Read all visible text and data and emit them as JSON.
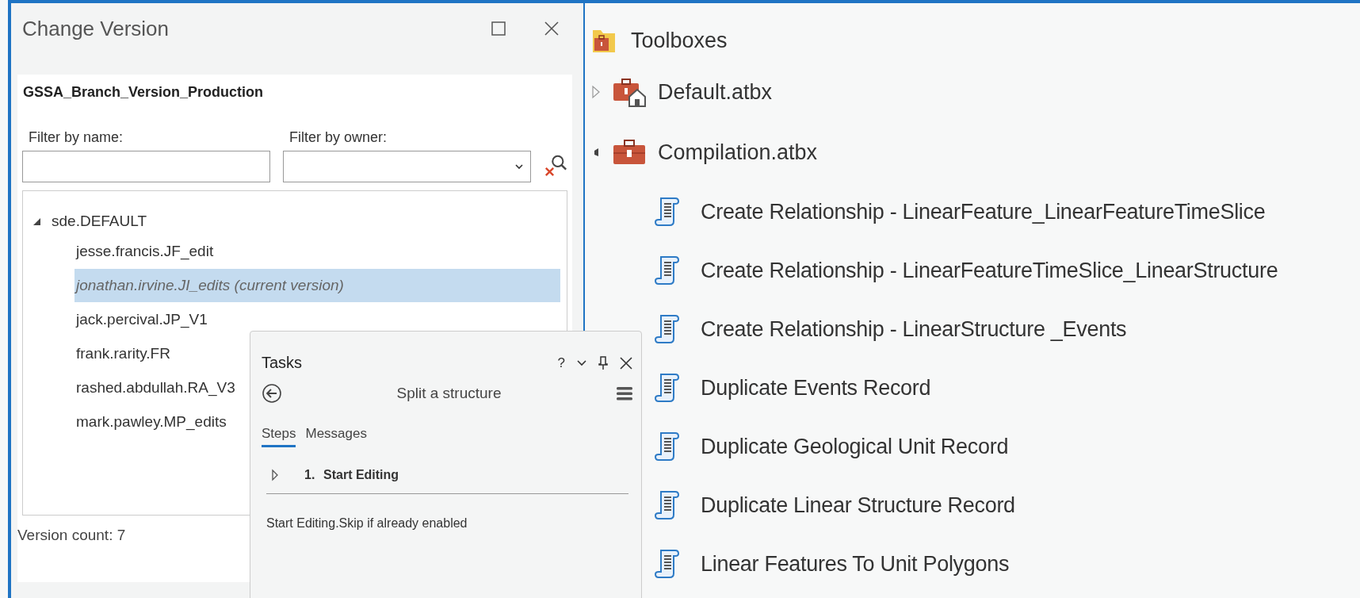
{
  "change_version": {
    "title": "Change Version",
    "database": "GSSA_Branch_Version_Production",
    "filter_name": {
      "label": "Filter by name:"
    },
    "filter_owner": {
      "label": "Filter by owner:"
    },
    "tree": [
      {
        "label": "sde.DEFAULT",
        "expanded": true,
        "children": [
          {
            "label": "jesse.francis.JF_edit",
            "selected": false,
            "current": false
          },
          {
            "label": "jonathan.irvine.JI_edits (current version)",
            "selected": true,
            "current": true
          },
          {
            "label": "jack.percival.JP_V1",
            "selected": false,
            "current": false
          },
          {
            "label": "frank.rarity.FR",
            "selected": false,
            "current": false
          },
          {
            "label": "rashed.abdullah.RA_V3",
            "selected": false,
            "current": false
          },
          {
            "label": "mark.pawley.MP_edits",
            "selected": false,
            "current": false
          }
        ]
      }
    ],
    "version_count": "Version count: 7"
  },
  "catalog": {
    "title": "Toolboxes",
    "toolboxes": [
      {
        "label": "Default.atbx",
        "kind": "default",
        "expanded": false
      },
      {
        "label": "Compilation.atbx",
        "kind": "toolbox",
        "expanded": true,
        "children": [
          {
            "label": "Create Relationship - LinearFeature_LinearFeatureTimeSlice"
          },
          {
            "label": "Create Relationship - LinearFeatureTimeSlice_LinearStructure"
          },
          {
            "label": "Create Relationship - LinearStructure _Events"
          },
          {
            "label": "Duplicate Events Record"
          },
          {
            "label": "Duplicate Geological Unit Record"
          },
          {
            "label": "Duplicate Linear Structure Record"
          },
          {
            "label": "Linear Features To Unit Polygons"
          }
        ]
      }
    ]
  },
  "tasks": {
    "title": "Tasks",
    "help": "?",
    "task_name": "Split a structure",
    "tabs": [
      {
        "label": "Steps",
        "selected": true
      },
      {
        "label": "Messages",
        "selected": false
      }
    ],
    "steps": [
      {
        "number": "1.",
        "label": "Start Editing",
        "expanded": false
      }
    ],
    "description": "Start Editing.Skip if already enabled"
  }
}
